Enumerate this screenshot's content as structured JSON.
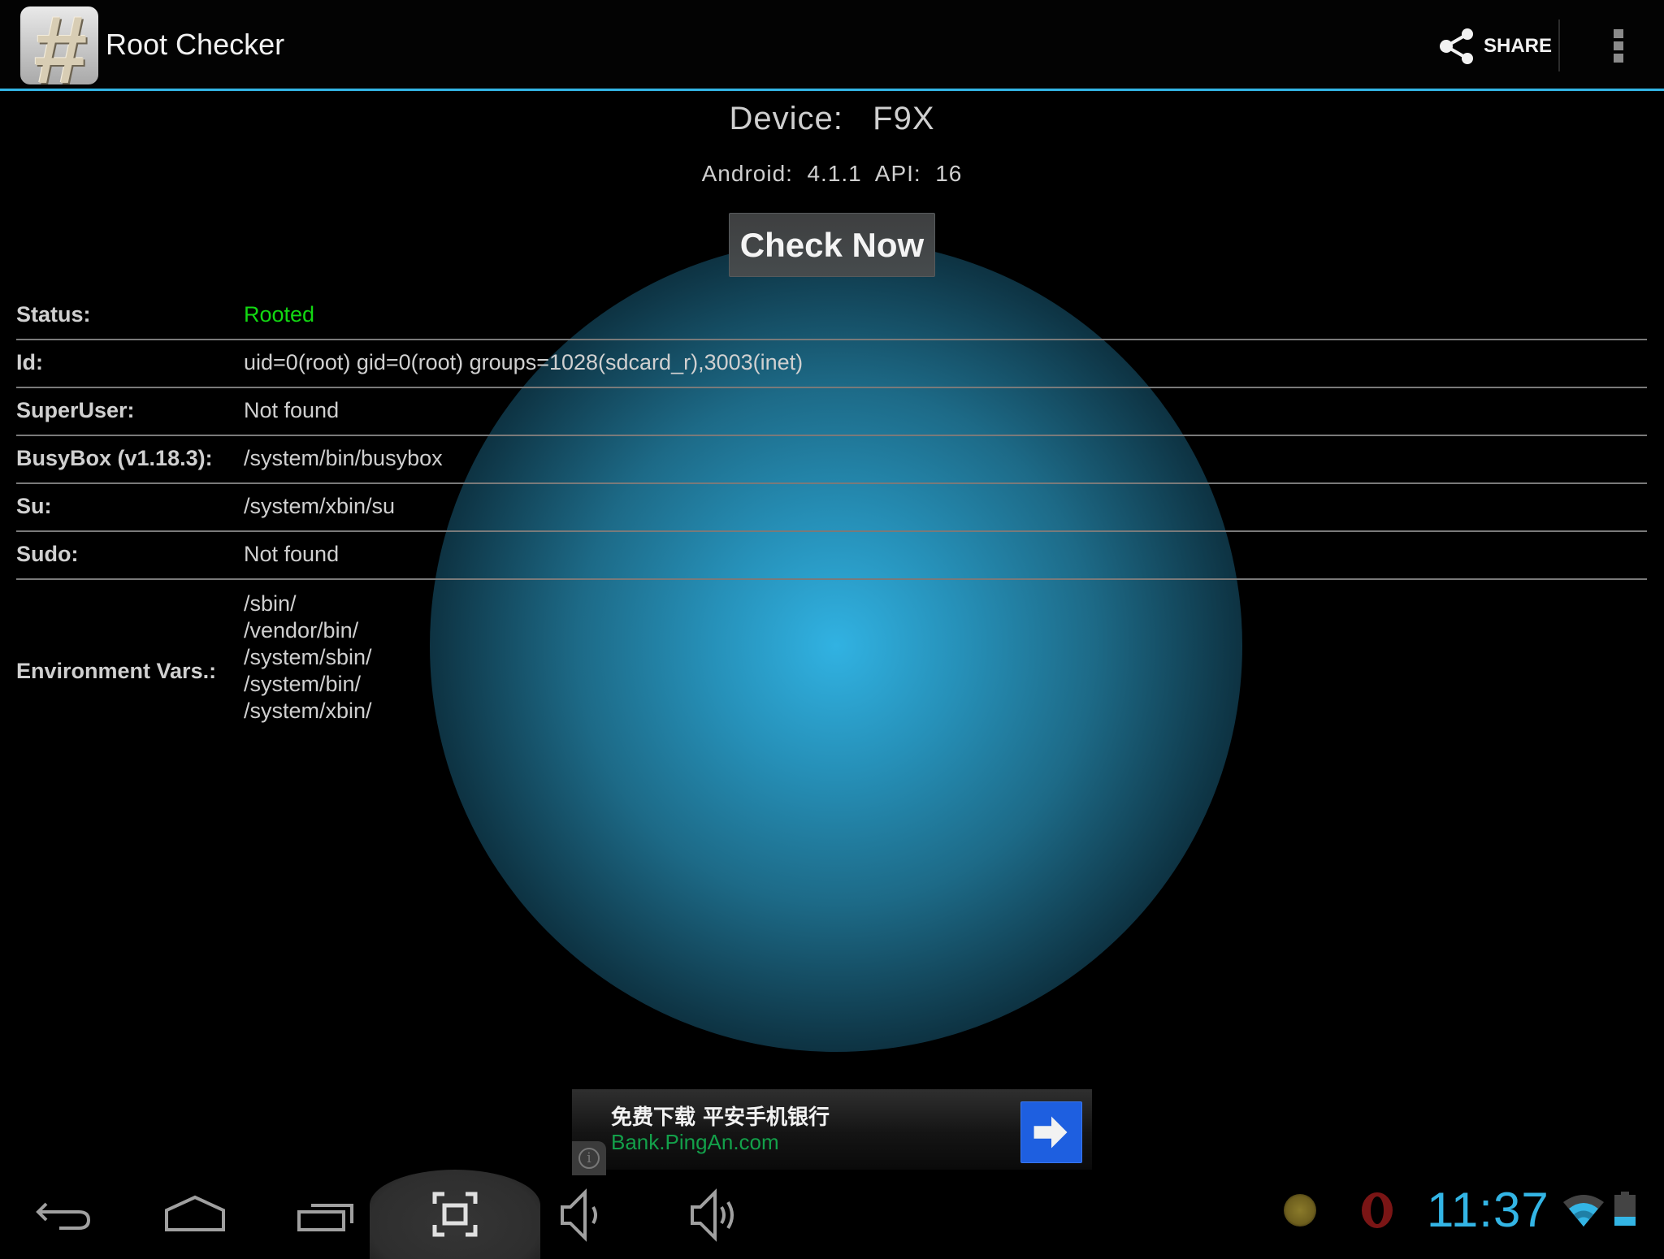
{
  "app": {
    "title": "Root Checker",
    "icon": "hash-icon",
    "share_label": "SHARE",
    "accent_color": "#33b5e5"
  },
  "device": {
    "label": "Device:   F9X",
    "android_line": "Android:  4.1.1  API:  16"
  },
  "check_button_label": "Check Now",
  "results": [
    {
      "label": "Status:",
      "value": "Rooted",
      "color": "#12d812"
    },
    {
      "label": "Id:",
      "value": "uid=0(root) gid=0(root) groups=1028(sdcard_r),3003(inet)"
    },
    {
      "label": "SuperUser:",
      "value": "Not found"
    },
    {
      "label": "BusyBox (v1.18.3):",
      "value": "/system/bin/busybox"
    },
    {
      "label": "Su:",
      "value": "/system/xbin/su"
    },
    {
      "label": "Sudo:",
      "value": "Not found"
    }
  ],
  "environment": {
    "label": "Environment Vars.:",
    "paths": [
      "/sbin/",
      "/vendor/bin/",
      "/system/sbin/",
      "/system/bin/",
      "/system/xbin/"
    ]
  },
  "ad": {
    "title": "免费下载 平安手机银行",
    "url": "Bank.PingAn.com",
    "info_glyph": "i"
  },
  "navbar": {
    "buttons": [
      "back",
      "home",
      "recent-apps",
      "screenshot",
      "volume-down",
      "volume-up"
    ]
  },
  "status_bar": {
    "time": "11:37",
    "battery_level": 0.3,
    "notifications": [
      "gold-coin-icon",
      "opera-icon"
    ]
  }
}
